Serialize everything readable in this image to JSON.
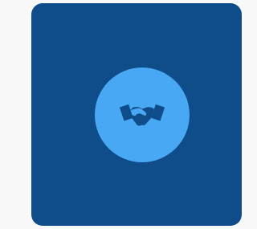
{
  "card": {
    "background_color": "#0f4c8a"
  },
  "badge": {
    "background_color": "#49a8f4",
    "icon": "handshake-icon",
    "icon_color": "#0f4c8a"
  },
  "page": {
    "background_color": "#f8f8f8"
  }
}
